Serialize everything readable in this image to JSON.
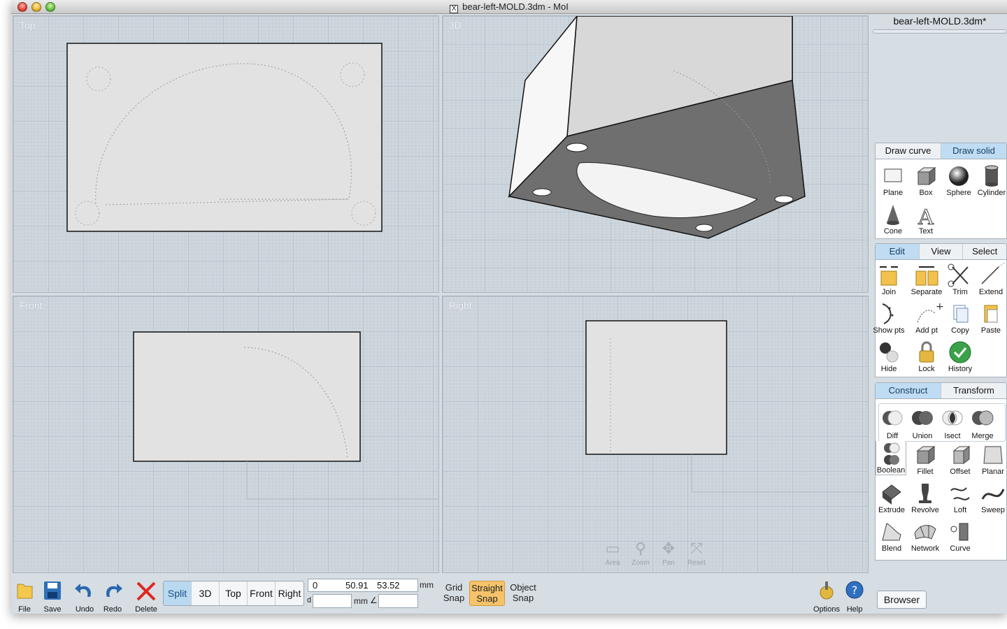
{
  "window": {
    "title": "bear-left-MOLD.3dm - MoI"
  },
  "viewports": {
    "top": {
      "label": "Top"
    },
    "3d": {
      "label": "3D"
    },
    "front": {
      "label": "Front"
    },
    "right": {
      "label": "Right"
    },
    "nav_tools": [
      {
        "label": "Area",
        "icon": "area-zoom-icon"
      },
      {
        "label": "Zoom",
        "icon": "zoom-icon"
      },
      {
        "label": "Pan",
        "icon": "pan-icon"
      },
      {
        "label": "Reset",
        "icon": "reset-icon"
      }
    ]
  },
  "toolbar": {
    "file": "File",
    "save": "Save",
    "undo": "Undo",
    "redo": "Redo",
    "delete": "Delete",
    "view_modes": [
      "Split",
      "3D",
      "Top",
      "Front",
      "Right"
    ],
    "active_view_mode": "Split",
    "coords": {
      "x": "0",
      "y": "50.91",
      "z": "53.52",
      "unit": "mm",
      "d_label": "d",
      "d_unit": "mm",
      "angle_symbol": "∠"
    },
    "grid_snap": "Grid\nSnap",
    "straight_snap": "Straight\nSnap",
    "object_snap": "Object\nSnap",
    "options": "Options",
    "help": "Help"
  },
  "side": {
    "document_name": "bear-left-MOLD.3dm*",
    "draw_tabs": [
      "Draw curve",
      "Draw solid"
    ],
    "draw_active": "Draw solid",
    "draw_tools": [
      "Plane",
      "Box",
      "Sphere",
      "Cylinder",
      "Cone",
      "Text"
    ],
    "edit_tabs": [
      "Edit",
      "View",
      "Select"
    ],
    "edit_active": "Edit",
    "edit_tools": [
      "Join",
      "Separate",
      "Trim",
      "Extend",
      "Show pts",
      "Add pt",
      "Copy",
      "Paste",
      "Hide",
      "Lock",
      "History"
    ],
    "construct_tabs": [
      "Construct",
      "Transform"
    ],
    "construct_active": "Construct",
    "boolean_tools": [
      "Diff",
      "Union",
      "Isect",
      "Merge"
    ],
    "construct_tools": [
      "Boolean",
      "Fillet",
      "Offset",
      "Planar",
      "Extrude",
      "Revolve",
      "Loft",
      "Sweep",
      "Blend",
      "Network",
      "Curve"
    ],
    "browser": "Browser"
  },
  "colors": {
    "viewport_bg": "#cfd7de",
    "active_tab": "#bfdcf2",
    "snap_on": "#f6c36b"
  }
}
